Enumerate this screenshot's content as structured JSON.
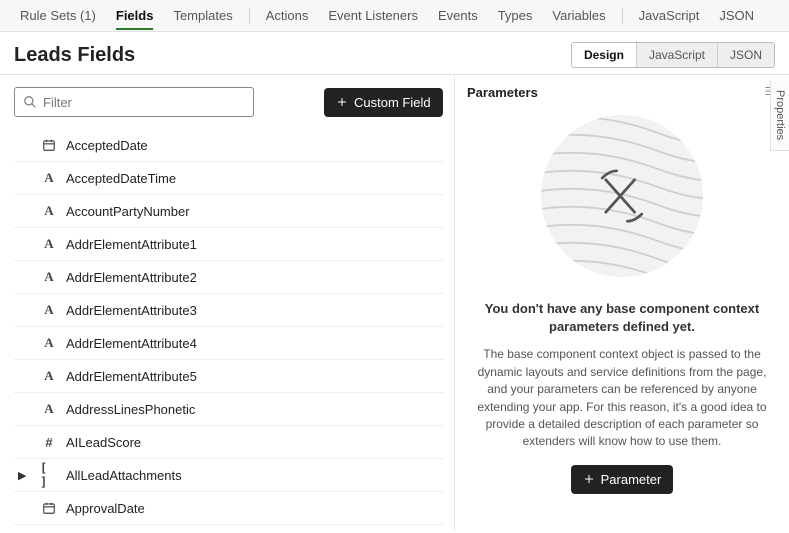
{
  "top_tabs": {
    "rule_sets": "Rule Sets (1)",
    "fields": "Fields",
    "templates": "Templates",
    "actions": "Actions",
    "event_listeners": "Event Listeners",
    "events": "Events",
    "types": "Types",
    "variables": "Variables",
    "javascript": "JavaScript",
    "json": "JSON"
  },
  "page_title": "Leads Fields",
  "view_toggle": {
    "design": "Design",
    "javascript": "JavaScript",
    "json": "JSON"
  },
  "filter": {
    "placeholder": "Filter"
  },
  "custom_field_btn": "Custom Field",
  "fields": [
    {
      "icon_name": "calendar-icon",
      "glyph": "📅",
      "label": "AcceptedDate"
    },
    {
      "icon_name": "text-icon",
      "glyph": "A",
      "label": "AcceptedDateTime"
    },
    {
      "icon_name": "text-icon",
      "glyph": "A",
      "label": "AccountPartyNumber"
    },
    {
      "icon_name": "text-icon",
      "glyph": "A",
      "label": "AddrElementAttribute1"
    },
    {
      "icon_name": "text-icon",
      "glyph": "A",
      "label": "AddrElementAttribute2"
    },
    {
      "icon_name": "text-icon",
      "glyph": "A",
      "label": "AddrElementAttribute3"
    },
    {
      "icon_name": "text-icon",
      "glyph": "A",
      "label": "AddrElementAttribute4"
    },
    {
      "icon_name": "text-icon",
      "glyph": "A",
      "label": "AddrElementAttribute5"
    },
    {
      "icon_name": "text-icon",
      "glyph": "A",
      "label": "AddressLinesPhonetic"
    },
    {
      "icon_name": "number-icon",
      "glyph": "#",
      "label": "AILeadScore"
    },
    {
      "icon_name": "array-icon",
      "glyph": "[ ]",
      "label": "AllLeadAttachments",
      "expandable": true
    },
    {
      "icon_name": "calendar-icon",
      "glyph": "📅",
      "label": "ApprovalDate"
    }
  ],
  "parameters_panel": {
    "title": "Parameters",
    "empty_heading": "You don't have any base component context parameters defined yet.",
    "empty_body": "The base component context object is passed to the dynamic layouts and service definitions from the page, and your parameters can be referenced by anyone extending your app. For this reason, it's a good idea to provide a detailed description of each parameter so extenders will know how to use them.",
    "add_btn": "Parameter"
  },
  "side_tab": "Properties"
}
